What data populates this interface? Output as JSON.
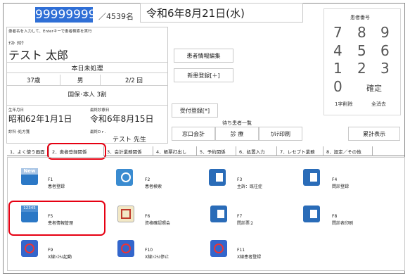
{
  "patient_bar": {
    "patient_id": "99999999",
    "count": "／4539名",
    "date": "令和6年8月21日(水)",
    "search_hint": "患者名を入力して、Enterキーで患者検索を実行"
  },
  "patient": {
    "kana": "ﾃｽﾄ ﾀﾛｳ",
    "name": "テスト 太郎",
    "status": "本日未処理",
    "age": "37歳",
    "sex": "男",
    "visit_count": "2/2 回",
    "insurance": "国保･本人 3割",
    "birth_label": "生年月日",
    "birth": "昭和62年1月1日",
    "last_visit_label": "最終診療日",
    "last_visit": "令和6年8月15日",
    "dept_label": "診科･処方箋",
    "doctor_label": "最終Dｒ.",
    "doctor": "テスト 先生"
  },
  "mid": {
    "edit_patient": "患者情報編集",
    "new_patient": "新患登録[＋]",
    "reception": "受付登録[*]",
    "waiting_label": "待ち患者一覧",
    "btn_checkout": "窓口会計",
    "btn_exam": "診 療",
    "btn_chart": "ｶﾙﾃ印刷",
    "btn_total": "累計表示"
  },
  "keypad": {
    "title": "患者番号",
    "keys": [
      "7",
      "8",
      "9",
      "4",
      "5",
      "6",
      "1",
      "2",
      "3",
      "0"
    ],
    "confirm": "確定",
    "del_one": "1字削除",
    "del_all": "全消去"
  },
  "tabs": [
    "1．よく使う画面",
    "2．患者登録関係",
    "3．会計業務関係",
    "4．帳票打出し",
    "5．予約関係",
    "6．処置入力",
    "7．レセプト業務",
    "8．設定／その他"
  ],
  "functions": [
    {
      "key": "F1",
      "label": "患者登録",
      "badge": "New"
    },
    {
      "key": "F2",
      "label": "患者検索"
    },
    {
      "key": "F3",
      "label": "主訴：既往症"
    },
    {
      "key": "F4",
      "label": "問診登録"
    },
    {
      "key": "F5",
      "label": "患者情報管理",
      "badge": "12345"
    },
    {
      "key": "F6",
      "label": "資格確認照会"
    },
    {
      "key": "F7",
      "label": "問診票２"
    },
    {
      "key": "F8",
      "label": "問診表印刷"
    },
    {
      "key": "F9",
      "label": "X線ｼｽﾃﾑ起動"
    },
    {
      "key": "F10",
      "label": "X線ｼｽﾃﾑ停止"
    },
    {
      "key": "F11",
      "label": "X線患者登録"
    }
  ]
}
